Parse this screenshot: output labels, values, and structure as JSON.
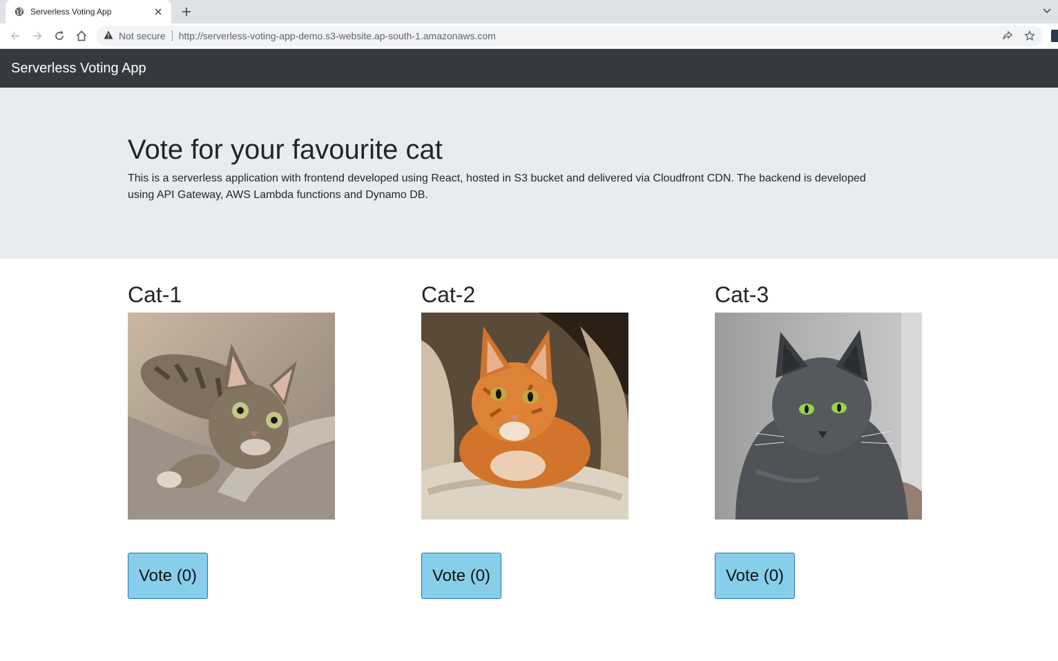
{
  "browser": {
    "tab_title": "Serverless Voting App",
    "security_label": "Not secure",
    "url": "http://serverless-voting-app-demo.s3-website.ap-south-1.amazonaws.com"
  },
  "navbar": {
    "brand": "Serverless Voting App",
    "background": "#343a40"
  },
  "hero": {
    "title": "Vote for your favourite cat",
    "description": "This is a serverless application with frontend developed using React, hosted in S3 bucket and delivered via Cloudfront CDN. The backend is developed using API Gateway, AWS Lambda functions and Dynamo DB."
  },
  "cats": [
    {
      "name": "Cat-1",
      "vote_label": "Vote (0)"
    },
    {
      "name": "Cat-2",
      "vote_label": "Vote (0)"
    },
    {
      "name": "Cat-3",
      "vote_label": "Vote (0)"
    }
  ],
  "colors": {
    "vote_button": "#87ceeb",
    "hero_bg": "#e9ecef"
  }
}
